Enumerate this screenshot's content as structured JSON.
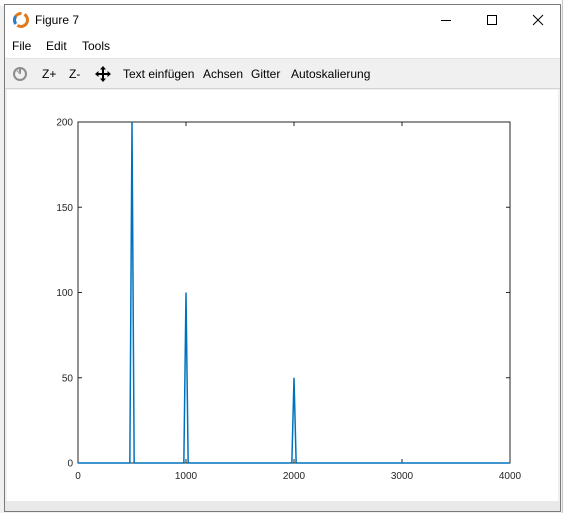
{
  "window": {
    "title": "Figure 7"
  },
  "menu": [
    "File",
    "Edit",
    "Tools"
  ],
  "toolbar": {
    "zoom_in": "Z+",
    "zoom_out": "Z-",
    "insert_text": "Text einfügen",
    "axes": "Achsen",
    "grid": "Gitter",
    "autoscale": "Autoskalierung"
  },
  "chart_data": {
    "type": "line",
    "title": "",
    "xlabel": "",
    "ylabel": "",
    "xlim": [
      0,
      4000
    ],
    "ylim": [
      0,
      200
    ],
    "xticks": [
      0,
      1000,
      2000,
      3000,
      4000
    ],
    "yticks": [
      0,
      50,
      100,
      150,
      200
    ],
    "grid": false,
    "series": [
      {
        "color": "#0072bd",
        "x": [
          0,
          480,
          500,
          520,
          980,
          1000,
          1020,
          1980,
          2000,
          2020,
          4000
        ],
        "y": [
          0,
          0,
          200,
          0,
          0,
          100,
          0,
          0,
          50,
          0,
          0
        ]
      }
    ]
  }
}
